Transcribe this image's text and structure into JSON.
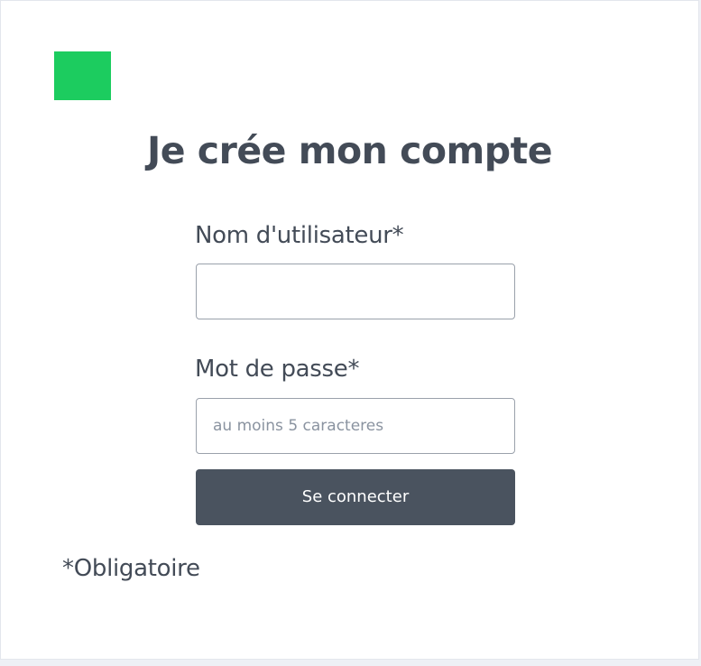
{
  "brand": {
    "logo_icon": "green-square-logo",
    "logo_color": "#1ccc5f"
  },
  "form": {
    "title": "Je crée mon compte",
    "username_label": "Nom d'utilisateur*",
    "username_value": "",
    "username_placeholder": "",
    "password_label": "Mot de passe*",
    "password_value": "",
    "password_placeholder": "au moins 5 caracteres",
    "submit_label": "Se connecter",
    "required_note": "*Obligatoire"
  },
  "colors": {
    "text": "#434b57",
    "button": "#4a535f",
    "accent": "#1ccc5f",
    "input_border": "#9aa1ab",
    "page_background": "#eef0f5"
  }
}
